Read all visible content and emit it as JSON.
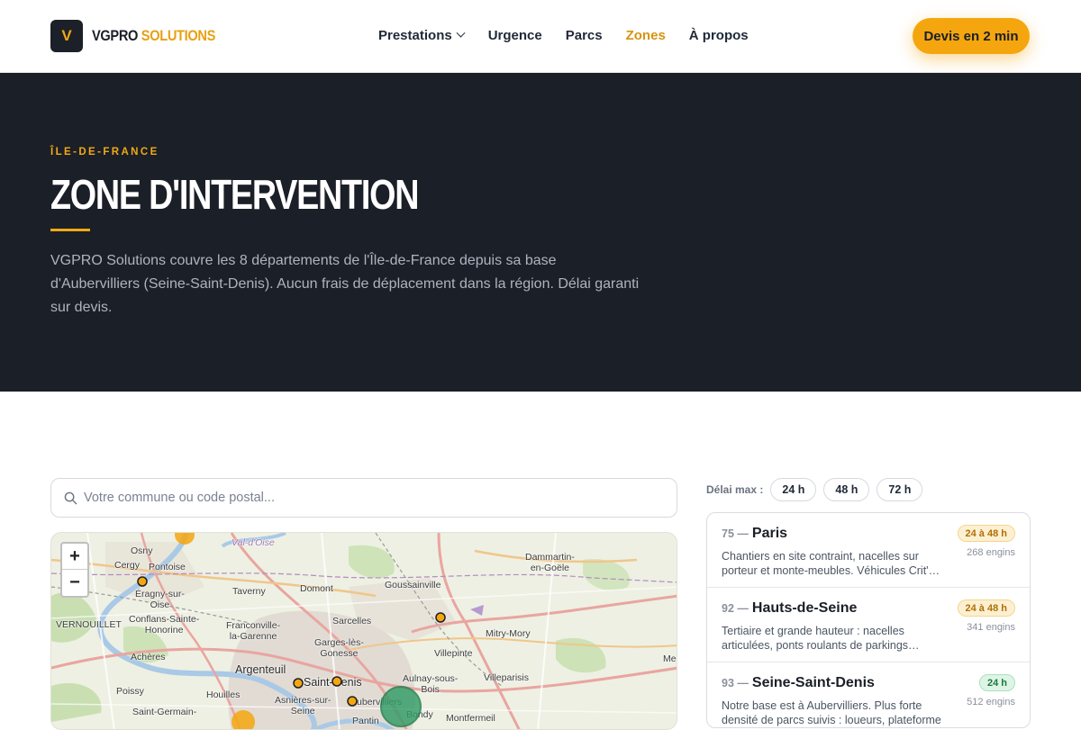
{
  "brand": {
    "mark": "V",
    "name_a": "VGPRO",
    "name_b": "SOLUTIONS"
  },
  "nav": {
    "items": [
      {
        "label": "Prestations"
      },
      {
        "label": "Urgence"
      },
      {
        "label": "Parcs"
      },
      {
        "label": "Zones"
      },
      {
        "label": "À propos"
      }
    ],
    "cta": "Devis en 2 min"
  },
  "hero": {
    "eyebrow": "ÎLE-DE-FRANCE",
    "title": "ZONE D'INTERVENTION",
    "description": "VGPRO Solutions couvre les 8 départements de l'Île-de-France depuis sa base d'Aubervilliers (Seine-Saint-Denis). Aucun frais de déplacement dans la région. Délai garanti sur devis."
  },
  "search": {
    "placeholder": "Votre commune ou code postal..."
  },
  "map": {
    "zoom_in": "+",
    "zoom_out": "−",
    "places": {
      "osny": "Osny",
      "cergy": "Cergy",
      "pontoise": "Pontoise",
      "val_doise": "Val-d'Oise",
      "eragny": "Éragny-sur-",
      "eragny2": "Oise",
      "conflans": "Conflans-Sainte-",
      "conflans2": "Honorine",
      "taverny": "Taverny",
      "domont": "Domont",
      "goussainville": "Goussainville",
      "dammartin": "Dammartin-",
      "dammartin2": "en-Goële",
      "franconville": "Franconville-",
      "franconville2": "la-Garenne",
      "sarcelles": "Sarcelles",
      "vernouillet": "VERNOUILLET",
      "garges": "Garges-lès-",
      "garges2": "Gonesse",
      "mitry": "Mitry-Mory",
      "acheres": "Achères",
      "villepinte": "Villepinte",
      "argenteuil": "Argenteuil",
      "saint_denis": "Saint-Denis",
      "aulnay": "Aulnay-sous-",
      "aulnay2": "Bois",
      "villeparisis": "Villeparisis",
      "poissy": "Poissy",
      "houilles": "Houilles",
      "asnieres": "Asnières-sur-",
      "asnieres2": "Seine",
      "aubervilliers": "Aubervilliers",
      "bondy": "Bondy",
      "montfermeil": "Montfermeil",
      "saint_germain": "Saint-Germain-",
      "pantin": "Pantin",
      "meaux": "Mea"
    }
  },
  "filter": {
    "label": "Délai max :",
    "chips": [
      "24 h",
      "48 h",
      "72 h"
    ]
  },
  "departments": [
    {
      "code": "75 —",
      "name": "Paris",
      "badge": "24 à 48 h",
      "engins": "268 engins",
      "desc": "Chantiers en site contraint, nacelles sur porteur et monte-meubles. Véhicules Crit'…"
    },
    {
      "code": "92 —",
      "name": "Hauts-de-Seine",
      "badge": "24 à 48 h",
      "engins": "341 engins",
      "desc": "Tertiaire et grande hauteur : nacelles articulées, ponts roulants de parkings…"
    },
    {
      "code": "93 —",
      "name": "Seine-Saint-Denis",
      "badge": "24 h",
      "engins": "512 engins",
      "desc": "Notre base est à Aubervilliers. Plus forte densité de parcs suivis : loueurs, plateforme"
    }
  ],
  "colors": {
    "accent": "#f5a60f",
    "dark": "#1b1f27",
    "badge_amber": "#fdf0d2",
    "badge_green": "#def5e6"
  }
}
